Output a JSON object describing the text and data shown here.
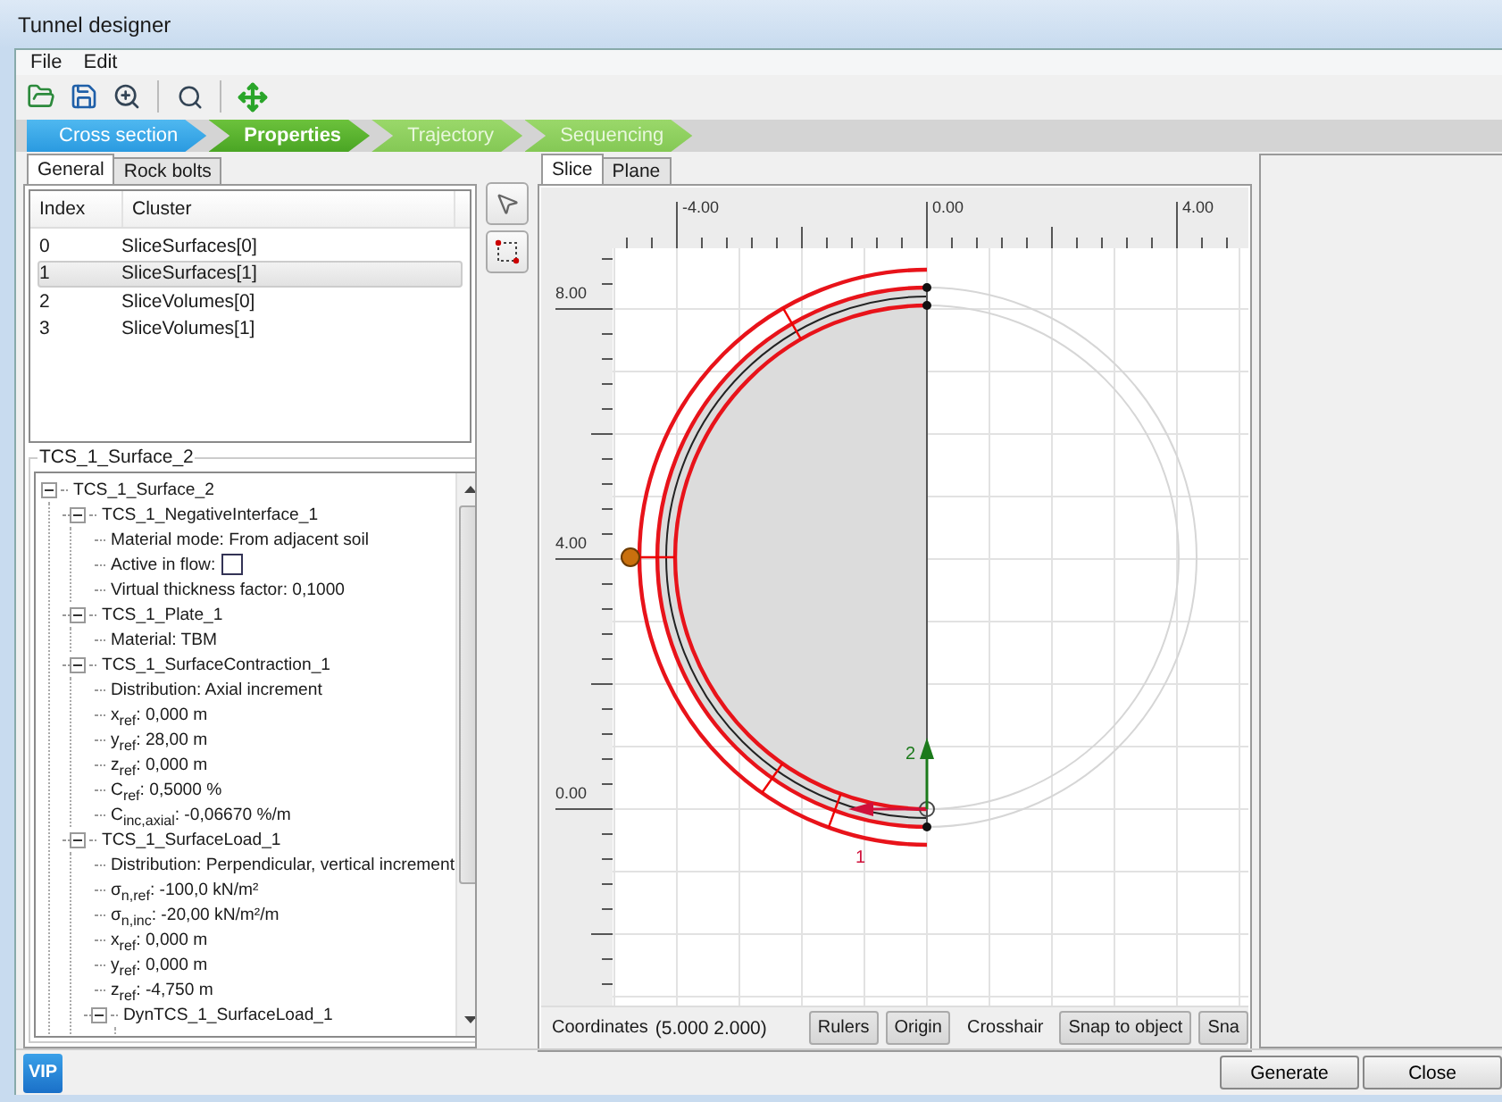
{
  "window": {
    "title": "Tunnel designer"
  },
  "menu": [
    "File",
    "Edit"
  ],
  "steps": [
    {
      "label": "Cross section",
      "selected": false,
      "visited": true
    },
    {
      "label": "Properties",
      "selected": true,
      "visited": false
    },
    {
      "label": "Trajectory",
      "selected": false,
      "visited": false
    },
    {
      "label": "Sequencing",
      "selected": false,
      "visited": false
    }
  ],
  "left_tabs": [
    {
      "label": "General",
      "selected": true
    },
    {
      "label": "Rock bolts",
      "selected": false
    }
  ],
  "table": {
    "columns": [
      "Index",
      "Cluster"
    ],
    "rows": [
      {
        "cells": [
          "0",
          "SliceSurfaces[0]"
        ],
        "selected": false
      },
      {
        "cells": [
          "1",
          "SliceSurfaces[1]"
        ],
        "selected": true
      },
      {
        "cells": [
          "2",
          "SliceVolumes[0]"
        ],
        "selected": false
      },
      {
        "cells": [
          "3",
          "SliceVolumes[1]"
        ],
        "selected": false
      }
    ]
  },
  "properties": {
    "title": "TCS_1_Surface_2",
    "tree": [
      {
        "kind": "group",
        "label": "TCS_1_Surface_2",
        "expanded": true,
        "children": [
          {
            "kind": "group",
            "label": "TCS_1_NegativeInterface_1",
            "expanded": true,
            "children": [
              {
                "kind": "text",
                "label": "Material mode: From adjacent soil"
              },
              {
                "kind": "checkbox",
                "label": "Active in flow:",
                "checked": false
              },
              {
                "kind": "text",
                "label": "Virtual thickness factor: 0,1000"
              }
            ]
          },
          {
            "kind": "group",
            "label": "TCS_1_Plate_1",
            "expanded": true,
            "children": [
              {
                "kind": "text",
                "label": "Material: TBM"
              }
            ]
          },
          {
            "kind": "group",
            "label": "TCS_1_SurfaceContraction_1",
            "expanded": true,
            "children": [
              {
                "kind": "text",
                "label": "Distribution: Axial increment"
              },
              {
                "kind": "text",
                "label": "x$_{ref}$: 0,000 m"
              },
              {
                "kind": "text",
                "label": "y$_{ref}$: 28,00 m"
              },
              {
                "kind": "text",
                "label": "z$_{ref}$: 0,000 m"
              },
              {
                "kind": "text",
                "label": "C$_{ref}$: 0,5000 %"
              },
              {
                "kind": "text",
                "label": "C$_{inc,axial}$: -0,06670 %/m"
              }
            ]
          },
          {
            "kind": "group",
            "label": "TCS_1_SurfaceLoad_1",
            "expanded": true,
            "children": [
              {
                "kind": "text",
                "label": "Distribution: Perpendicular, vertical increment"
              },
              {
                "kind": "text",
                "label": "σ$_{n,ref}$: -100,0 kN/m²"
              },
              {
                "kind": "text",
                "label": "σ$_{n,inc}$: -20,00 kN/m²/m"
              },
              {
                "kind": "text",
                "label": "x$_{ref}$: 0,000 m"
              },
              {
                "kind": "text",
                "label": "y$_{ref}$: 0,000 m"
              },
              {
                "kind": "text",
                "label": "z$_{ref}$: -4,750 m"
              },
              {
                "kind": "group",
                "label": "DynTCS_1_SurfaceLoad_1",
                "expanded": true
              }
            ]
          }
        ]
      }
    ]
  },
  "view_tabs": [
    {
      "label": "Slice",
      "selected": true
    },
    {
      "label": "Plane",
      "selected": false
    }
  ],
  "canvas": {
    "x_ruler": [
      "-4.00",
      "0.00",
      "4.00"
    ],
    "y_ruler": [
      "8.00",
      "4.00",
      "0.00"
    ],
    "direction_labels": [
      "2",
      "1"
    ]
  },
  "status": {
    "label": "Coordinates",
    "value": "(5.000 2.000)",
    "toggles": [
      {
        "label": "Rulers",
        "on": true
      },
      {
        "label": "Origin",
        "on": true
      },
      {
        "label": "Crosshair",
        "on": false
      },
      {
        "label": "Snap to object",
        "on": true
      },
      {
        "label": "Sna",
        "on": true
      }
    ]
  },
  "footer": {
    "logo": "VIP",
    "buttons": [
      "Generate",
      "Close"
    ]
  }
}
